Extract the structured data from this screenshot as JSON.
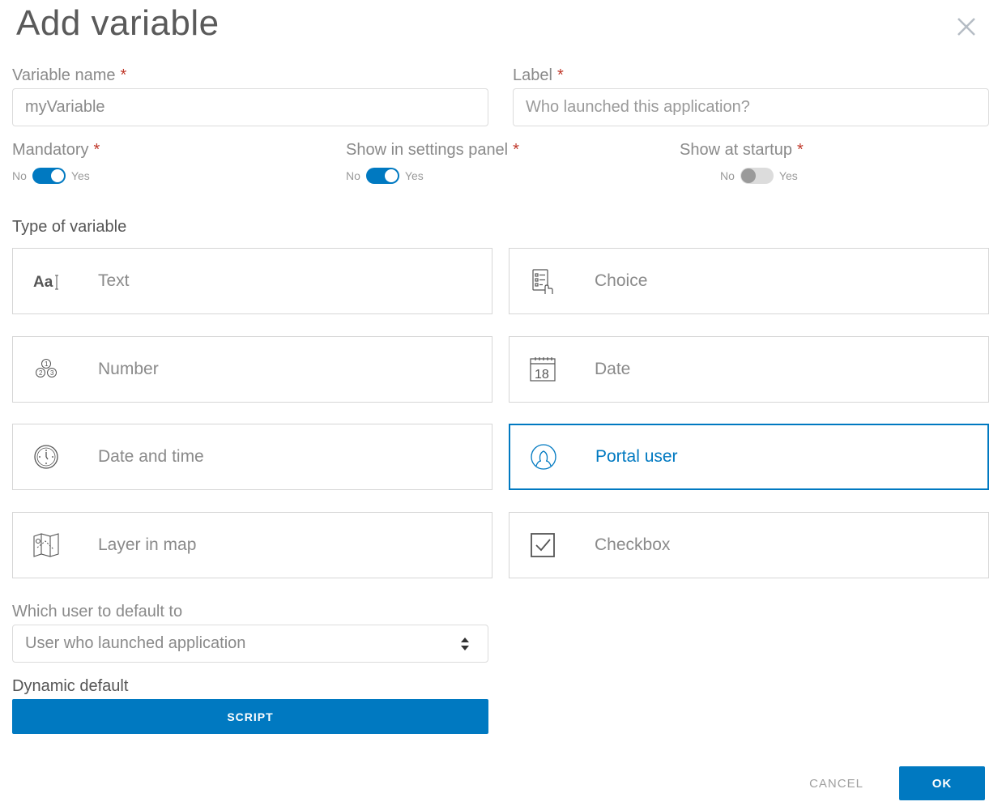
{
  "dialog": {
    "title": "Add variable",
    "close_icon": "close-icon",
    "required_marker": "*"
  },
  "fields": {
    "variable_name": {
      "label": "Variable name",
      "value": "myVariable"
    },
    "label": {
      "label": "Label",
      "placeholder": "Who launched this application?"
    }
  },
  "toggles": [
    {
      "label": "Mandatory",
      "no": "No",
      "yes": "Yes",
      "on": true
    },
    {
      "label": "Show in settings panel",
      "no": "No",
      "yes": "Yes",
      "on": true
    },
    {
      "label": "Show at startup",
      "no": "No",
      "yes": "Yes",
      "on": false
    }
  ],
  "type_section": {
    "heading": "Type of variable",
    "types": [
      {
        "label": "Text",
        "icon": "text-aa-icon",
        "selected": false
      },
      {
        "label": "Choice",
        "icon": "choice-list-icon",
        "selected": false
      },
      {
        "label": "Number",
        "icon": "number-icon",
        "selected": false
      },
      {
        "label": "Date",
        "icon": "calendar-icon",
        "selected": false
      },
      {
        "label": "Date and time",
        "icon": "clock-icon",
        "selected": false
      },
      {
        "label": "Portal user",
        "icon": "user-icon",
        "selected": true
      },
      {
        "label": "Layer in map",
        "icon": "map-layer-icon",
        "selected": false
      },
      {
        "label": "Checkbox",
        "icon": "checkbox-icon",
        "selected": false
      }
    ]
  },
  "calendar_day": "18",
  "number_icon_digits": [
    "1",
    "2",
    "3"
  ],
  "default_user": {
    "label": "Which user to default to",
    "selected": "User who launched application"
  },
  "dynamic_default": {
    "label": "Dynamic default",
    "button": "SCRIPT"
  },
  "footer": {
    "cancel": "CANCEL",
    "ok": "OK"
  },
  "colors": {
    "accent": "#0079c1",
    "required": "#c0392b",
    "border": "#d6d6d6"
  }
}
